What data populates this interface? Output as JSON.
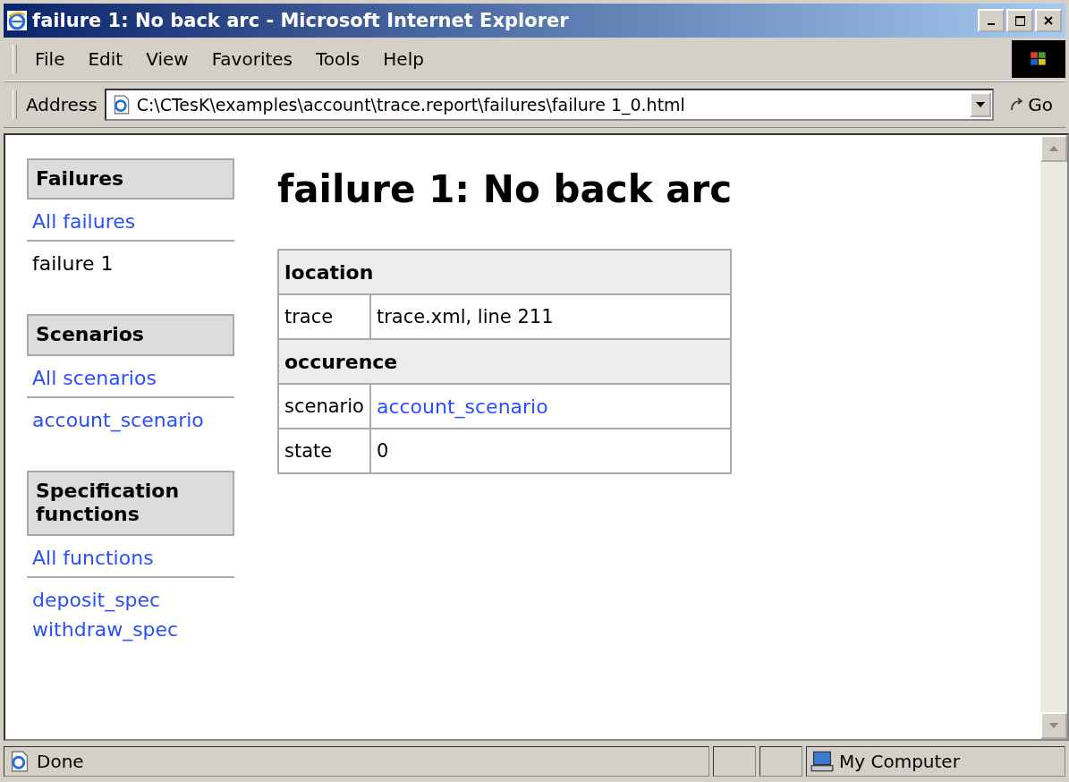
{
  "window": {
    "title": "failure 1: No back arc - Microsoft Internet Explorer"
  },
  "menu": [
    "File",
    "Edit",
    "View",
    "Favorites",
    "Tools",
    "Help"
  ],
  "address_bar": {
    "label": "Address",
    "value": "C:\\CTesK\\examples\\account\\trace.report\\failures\\failure 1_0.html",
    "go": "Go"
  },
  "sidebar": {
    "sections": [
      {
        "heading": "Failures",
        "all_link": "All failures",
        "items": [
          {
            "text": "failure 1",
            "link": false
          }
        ]
      },
      {
        "heading": "Scenarios",
        "all_link": "All scenarios",
        "items": [
          {
            "text": "account_scenario",
            "link": true
          }
        ]
      },
      {
        "heading": "Specification functions",
        "all_link": "All functions",
        "items": [
          {
            "text": "deposit_spec",
            "link": true
          },
          {
            "text": "withdraw_spec",
            "link": true
          }
        ]
      }
    ]
  },
  "page": {
    "title": "failure 1: No back arc",
    "table": [
      {
        "kind": "header",
        "text": "location"
      },
      {
        "kind": "field",
        "label": "trace",
        "value": "trace.xml, line 211",
        "link": false
      },
      {
        "kind": "header",
        "text": "occurence"
      },
      {
        "kind": "field",
        "label": "scenario",
        "value": "account_scenario",
        "link": true
      },
      {
        "kind": "field",
        "label": "state",
        "value": "0",
        "link": false
      }
    ]
  },
  "status_bar": {
    "text": "Done",
    "zone": "My Computer"
  }
}
